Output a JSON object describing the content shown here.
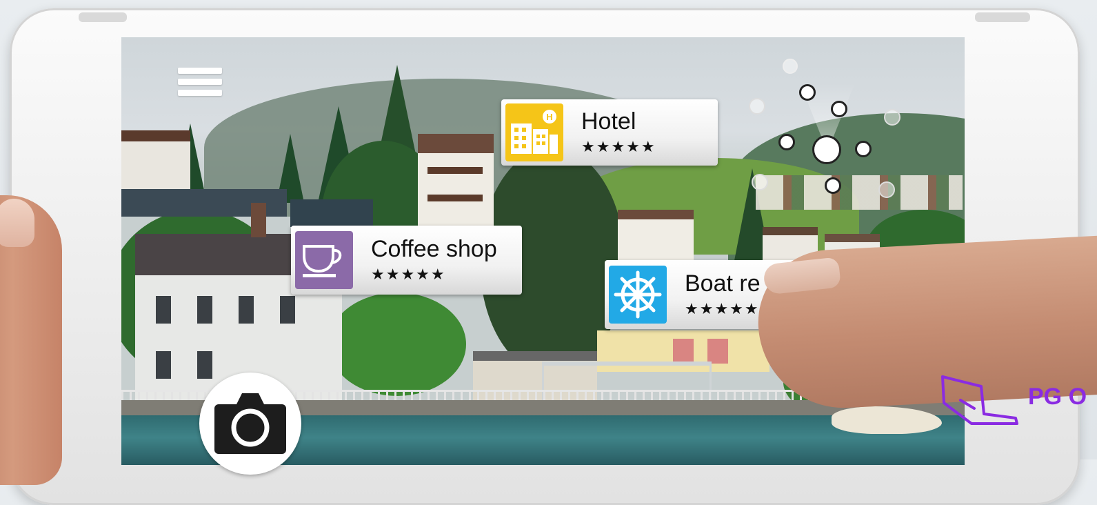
{
  "colors": {
    "hotel_icon_bg": "#f5c518",
    "coffee_icon_bg": "#8b6aa8",
    "boat_icon_bg": "#22a9e6",
    "logo_color": "#8a2be2"
  },
  "ar_labels": [
    {
      "name": "Hotel",
      "stars": "★★★★★",
      "icon": "hotel-buildings-icon"
    },
    {
      "name": "Coffee shop",
      "stars": "★★★★★",
      "icon": "coffee-cup-icon"
    },
    {
      "name": "Boat re",
      "stars": "★★★★★",
      "icon": "ship-wheel-icon"
    }
  ],
  "icons": {
    "menu": "hamburger-menu-icon",
    "camera": "camera-icon",
    "radar": "radar-icon"
  },
  "logo": {
    "text": "PG O"
  }
}
